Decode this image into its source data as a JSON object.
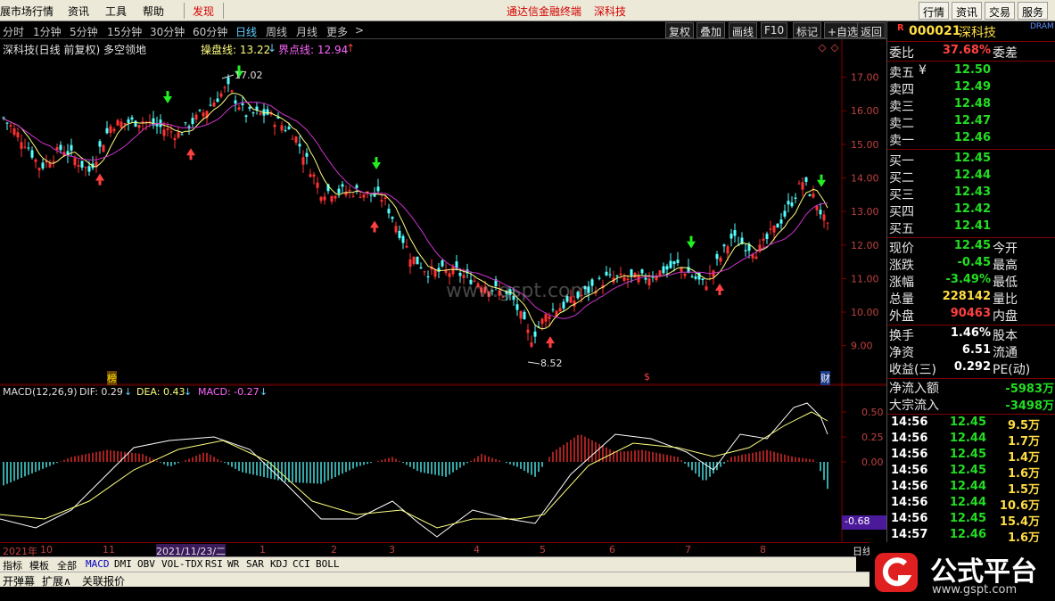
{
  "menu": {
    "items": [
      "展市场行情",
      "资讯",
      "工具",
      "帮助"
    ],
    "highlight": "发现",
    "center_a": "通达信金融终端",
    "center_b": "深科技",
    "right_buttons": [
      "行情",
      "资讯",
      "交易",
      "服务"
    ]
  },
  "periods": {
    "items": [
      "分时",
      "1分钟",
      "5分钟",
      "15分钟",
      "30分钟",
      "60分钟",
      "日线",
      "周线",
      "月线",
      "更多",
      ">"
    ],
    "active": "日线",
    "toolbar": [
      "复权",
      "叠加",
      "画线",
      "F10",
      "标记",
      "+自选",
      "返回"
    ]
  },
  "chart_header": {
    "title": "深科技(日线 前复权) 多空领地",
    "line1_label": "操盘线: 13.22",
    "line1_arrow": "↓",
    "line2_label": "界点线: 12.94",
    "line2_arrow": "↑",
    "high_label": "17.02",
    "low_label": "8.52",
    "watermark": "www.gspt.com",
    "marker_bang": "榜",
    "marker_s": "$",
    "marker_cai": "财"
  },
  "macd_header": {
    "name": "MACD(12,26,9)",
    "dif": "DIF: 0.29",
    "dif_arrow": "↓",
    "dea": "DEA: 0.43",
    "dea_arrow": "↓",
    "macd": "MACD: -0.27",
    "macd_arrow": "↓",
    "current_value": "-0.68"
  },
  "price_axis": [
    "17.00",
    "16.00",
    "15.00",
    "14.00",
    "13.00",
    "12.00",
    "11.00",
    "10.00",
    "9.00"
  ],
  "macd_axis": [
    "0.50",
    "0.25",
    "0.00"
  ],
  "date_axis": {
    "labels": [
      "2021年",
      "10",
      "11",
      "2021/11/23/二",
      "1",
      "2",
      "3",
      "4",
      "5",
      "6",
      "7",
      "8"
    ],
    "corner": "日线"
  },
  "indicator_tabs": [
    "指标",
    "模板",
    "全部",
    "MACD",
    "DMI",
    "OBV",
    "VOL-TDX",
    "RSI",
    "WR",
    "SAR",
    "KDJ",
    "CCI",
    "BOLL"
  ],
  "bottom_bar": [
    "开弹幕",
    "扩展∧",
    "关联报价"
  ],
  "quote": {
    "code": "000021",
    "name": "深科技",
    "badge_r": "R",
    "badge_dram": "DRAM",
    "weibi_label": "委比",
    "weibi_val": "37.68%",
    "weicha_label": "委差",
    "sells": [
      {
        "label": "卖五",
        "price": "12.50"
      },
      {
        "label": "卖四",
        "price": "12.49"
      },
      {
        "label": "卖三",
        "price": "12.48"
      },
      {
        "label": "卖二",
        "price": "12.47"
      },
      {
        "label": "卖一",
        "price": "12.46"
      }
    ],
    "yen": "¥",
    "buys": [
      {
        "label": "买一",
        "price": "12.45"
      },
      {
        "label": "买二",
        "price": "12.44"
      },
      {
        "label": "买三",
        "price": "12.43"
      },
      {
        "label": "买四",
        "price": "12.42"
      },
      {
        "label": "买五",
        "price": "12.41"
      }
    ],
    "stats": [
      {
        "label": "现价",
        "val": "12.45",
        "cls": "green",
        "label2": "今开"
      },
      {
        "label": "涨跌",
        "val": "-0.45",
        "cls": "green",
        "label2": "最高"
      },
      {
        "label": "涨幅",
        "val": "-3.49%",
        "cls": "green",
        "label2": "最低"
      },
      {
        "label": "总量",
        "val": "228142",
        "cls": "yellow",
        "label2": "量比"
      },
      {
        "label": "外盘",
        "val": "90463",
        "cls": "red",
        "label2": "内盘"
      }
    ],
    "stats2": [
      {
        "label": "换手",
        "val": "1.46%",
        "label2": "股本"
      },
      {
        "label": "净资",
        "val": "6.51",
        "label2": "流通"
      },
      {
        "label": "收益(三)",
        "val": "0.292",
        "label2": "PE(动)"
      }
    ],
    "flows": [
      {
        "label": "净流入额",
        "val": "-5983万"
      },
      {
        "label": "大宗流入",
        "val": "-3498万"
      }
    ],
    "ticks": [
      {
        "time": "14:56",
        "price": "12.45",
        "vol": "9.5万"
      },
      {
        "time": "14:56",
        "price": "12.44",
        "vol": "1.7万"
      },
      {
        "time": "14:56",
        "price": "12.45",
        "vol": "1.4万"
      },
      {
        "time": "14:56",
        "price": "12.45",
        "vol": "1.6万"
      },
      {
        "time": "14:56",
        "price": "12.44",
        "vol": "1.5万"
      },
      {
        "time": "14:56",
        "price": "12.44",
        "vol": "10.6万"
      },
      {
        "time": "14:56",
        "price": "12.45",
        "vol": "15.4万"
      },
      {
        "time": "14:57",
        "price": "12.46",
        "vol": "1.6万"
      }
    ]
  },
  "logo": {
    "text": "公式平台",
    "url": "www.gspt.com"
  },
  "colors": {
    "up": "#ff3232",
    "down": "#54ffff",
    "ma_yellow": "#ffff80",
    "ma_purple": "#cc33cc",
    "axis": "#800000"
  }
}
